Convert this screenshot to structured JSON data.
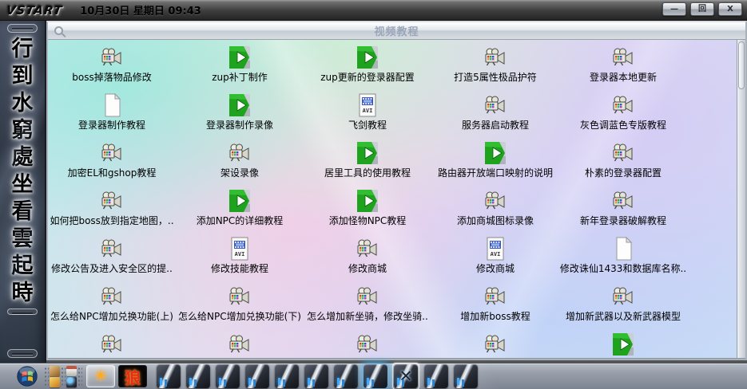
{
  "topbar": {
    "logo": "VSTART",
    "datetime": "10月30日  星期日  09:43",
    "minimize_label": "—",
    "maximize_label": "回",
    "close_label": "X"
  },
  "side_banner": {
    "poem_chars": [
      "行",
      "到",
      "水",
      "窮",
      "處",
      "坐",
      "看",
      "雲",
      "起",
      "時"
    ]
  },
  "window": {
    "title": "视频教程",
    "items": [
      {
        "label": "boss掉落物品修改",
        "icon": "camera"
      },
      {
        "label": "zup补丁制作",
        "icon": "player"
      },
      {
        "label": "zup更新的登录器配置",
        "icon": "player"
      },
      {
        "label": "打造5属性极品护符",
        "icon": "camera"
      },
      {
        "label": "登录器本地更新",
        "icon": "camera"
      },
      {
        "label": "登录器制作教程",
        "icon": "doc"
      },
      {
        "label": "登录器制作录像",
        "icon": "player"
      },
      {
        "label": "飞剑教程",
        "icon": "avi"
      },
      {
        "label": "服务器启动教程",
        "icon": "camera"
      },
      {
        "label": "灰色调蓝色专版教程",
        "icon": "camera"
      },
      {
        "label": "加密EL和gshop教程",
        "icon": "camera"
      },
      {
        "label": "架设录像",
        "icon": "camera"
      },
      {
        "label": "居里工具的使用教程",
        "icon": "player"
      },
      {
        "label": "路由器开放端口映射的说明",
        "icon": "player"
      },
      {
        "label": "朴素的登录器配置",
        "icon": "camera"
      },
      {
        "label": "如何把boss放到指定地图，..",
        "icon": "camera"
      },
      {
        "label": "添加NPC的详细教程",
        "icon": "player"
      },
      {
        "label": "添加怪物NPC教程",
        "icon": "player"
      },
      {
        "label": "添加商城图标录像",
        "icon": "camera"
      },
      {
        "label": "新年登录器破解教程",
        "icon": "camera"
      },
      {
        "label": "修改公告及进入安全区的提..",
        "icon": "camera"
      },
      {
        "label": "修改技能教程",
        "icon": "avi"
      },
      {
        "label": "修改商城",
        "icon": "camera"
      },
      {
        "label": "修改商城",
        "icon": "avi"
      },
      {
        "label": "修改诛仙1433和数据库名称..",
        "icon": "doc"
      },
      {
        "label": "怎么给NPC增加兑换功能(上)",
        "icon": "camera"
      },
      {
        "label": "怎么给NPC增加兑换功能(下)",
        "icon": "camera"
      },
      {
        "label": "怎么增加新坐骑，修改坐骑..",
        "icon": "camera"
      },
      {
        "label": "增加新boss教程",
        "icon": "camera"
      },
      {
        "label": "增加新武器以及新武器模型",
        "icon": "camera"
      }
    ],
    "partial_row_icons": [
      "camera",
      "camera",
      "camera",
      "camera",
      "player"
    ]
  },
  "taskbar": {
    "quick_launch_icons": [
      "box",
      "clipboard",
      "cubes",
      "orb"
    ],
    "sun_glyph": "☀",
    "wolf_glyph": "狼",
    "folders": [
      "plain",
      "plain",
      "plain",
      "plain",
      "plain",
      "plain",
      "plain",
      "glow",
      "selected",
      "plain",
      "plain"
    ],
    "selected_folder_glyph": "✕"
  },
  "colors": {
    "player_green": "#1fa31f",
    "avi_blue": "#3a5ac0",
    "sun_orange": "#ffaa1e",
    "wolf_red": "#e23010",
    "accent_blue": "#3fa9ff"
  }
}
